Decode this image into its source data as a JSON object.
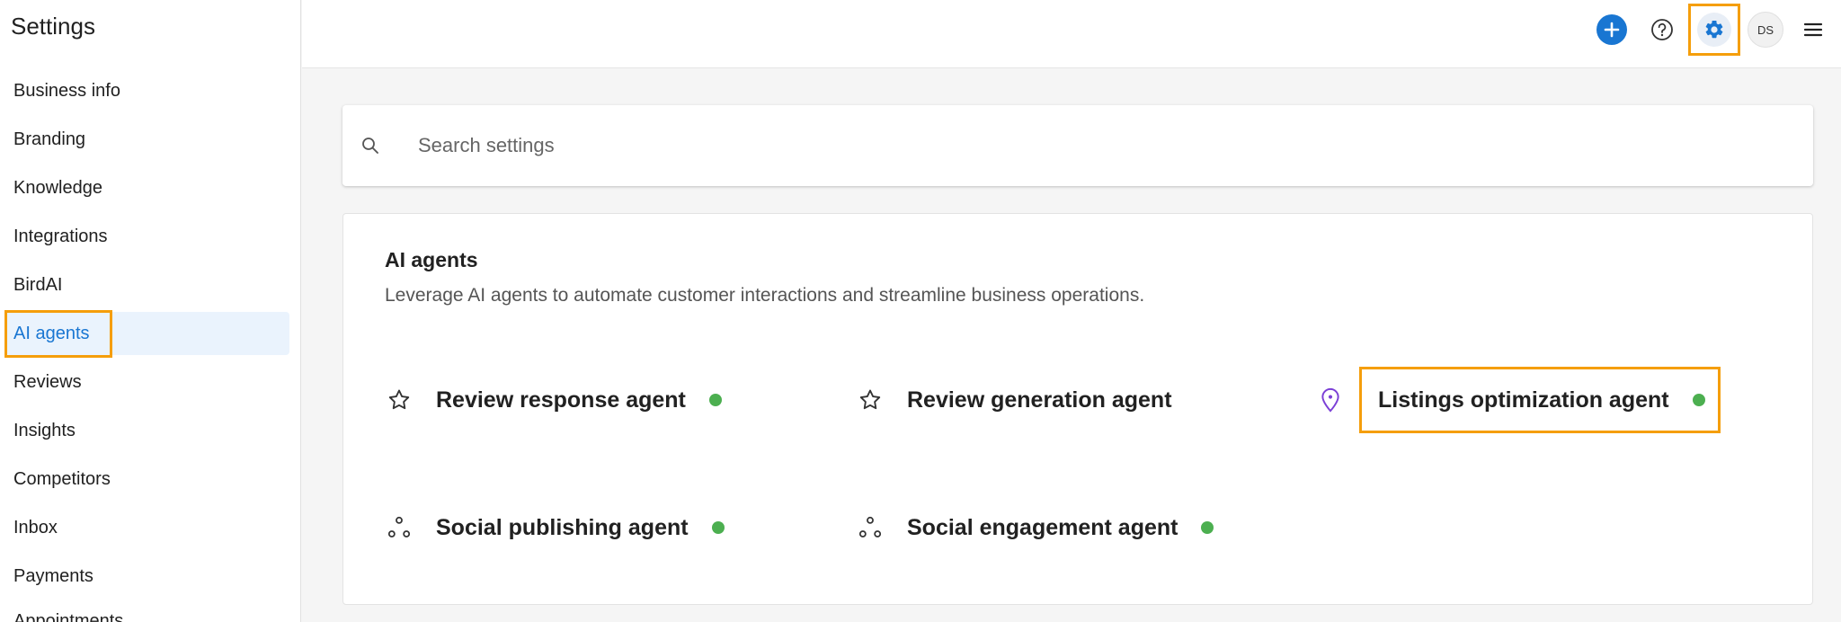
{
  "sidebar": {
    "title": "Settings",
    "items": [
      {
        "label": "Business info"
      },
      {
        "label": "Branding"
      },
      {
        "label": "Knowledge"
      },
      {
        "label": "Integrations"
      },
      {
        "label": "BirdAI"
      },
      {
        "label": "AI agents",
        "active": true
      },
      {
        "label": "Reviews"
      },
      {
        "label": "Insights"
      },
      {
        "label": "Competitors"
      },
      {
        "label": "Inbox"
      },
      {
        "label": "Payments"
      },
      {
        "label": "Appointments"
      }
    ]
  },
  "topbar": {
    "avatar_initials": "DS",
    "icons": [
      "plus-icon",
      "help-icon",
      "gear-icon",
      "menu-icon"
    ]
  },
  "search": {
    "placeholder": "Search settings",
    "value": ""
  },
  "agents_card": {
    "title": "AI agents",
    "description": "Leverage AI agents to automate customer interactions and streamline business operations.",
    "agents": [
      {
        "label": "Review response agent",
        "icon": "star-icon",
        "status": "active"
      },
      {
        "label": "Review generation agent",
        "icon": "star-icon",
        "status": ""
      },
      {
        "label": "Listings optimization agent",
        "icon": "location-pin-icon",
        "status": "active"
      },
      {
        "label": "Social publishing agent",
        "icon": "share-dots-icon",
        "status": "active"
      },
      {
        "label": "Social engagement agent",
        "icon": "share-dots-icon",
        "status": "active"
      }
    ]
  },
  "colors": {
    "accent": "#1976d2",
    "status_active": "#4caf50",
    "highlight": "#f59e0b",
    "pin_icon": "#7b3fd6"
  }
}
